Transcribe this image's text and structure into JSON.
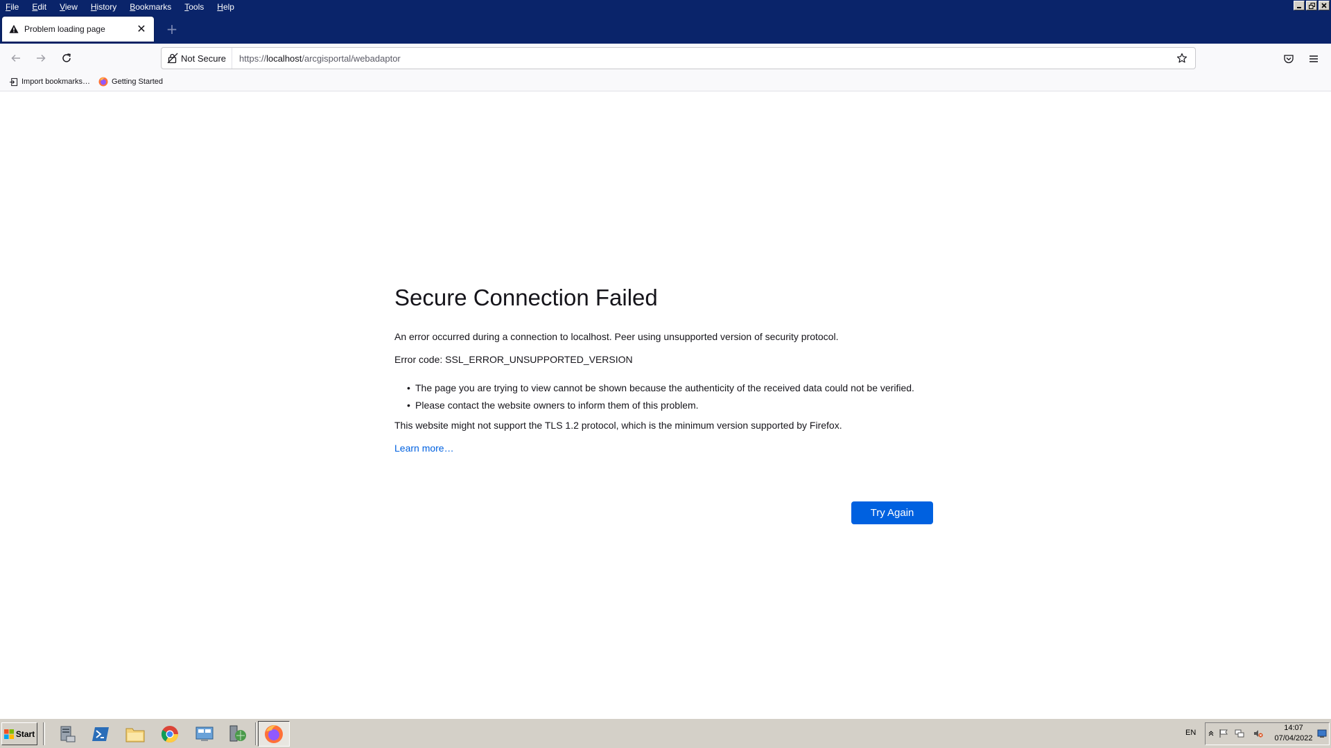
{
  "menubar": {
    "items": [
      {
        "access_key": "F",
        "rest": "ile"
      },
      {
        "access_key": "E",
        "rest": "dit"
      },
      {
        "access_key": "V",
        "rest": "iew"
      },
      {
        "access_key": "H",
        "rest": "istory"
      },
      {
        "access_key": "B",
        "rest": "ookmarks"
      },
      {
        "access_key": "T",
        "rest": "ools"
      },
      {
        "access_key": "H",
        "rest": "elp"
      }
    ]
  },
  "tab": {
    "title": "Problem loading page",
    "close_glyph": "✕",
    "new_tab_glyph": "+"
  },
  "urlbar": {
    "security_label": "Not Secure",
    "url_prefix": "https://",
    "url_host": "localhost",
    "url_path": "/arcgisportal/webadaptor"
  },
  "bookmarks": {
    "items": [
      {
        "label": "Import bookmarks…",
        "icon": "import-icon"
      },
      {
        "label": "Getting Started",
        "icon": "firefox-icon"
      }
    ]
  },
  "error": {
    "title": "Secure Connection Failed",
    "description": "An error occurred during a connection to localhost. Peer using unsupported version of security protocol.",
    "code_line": "Error code: SSL_ERROR_UNSUPPORTED_VERSION",
    "bullets": [
      "The page you are trying to view cannot be shown because the authenticity of the received data could not be verified.",
      "Please contact the website owners to inform them of this problem."
    ],
    "tls_note": "This website might not support the TLS 1.2 protocol, which is the minimum version supported by Firefox.",
    "learn_more": "Learn more…",
    "try_again": "Try Again"
  },
  "taskbar": {
    "start_label": "Start",
    "language": "EN",
    "time": "14:07",
    "date": "07/04/2022"
  },
  "colors": {
    "title_bar": "#0a246a",
    "accent_blue": "#0061e0",
    "taskbar": "#d4d0c8"
  }
}
